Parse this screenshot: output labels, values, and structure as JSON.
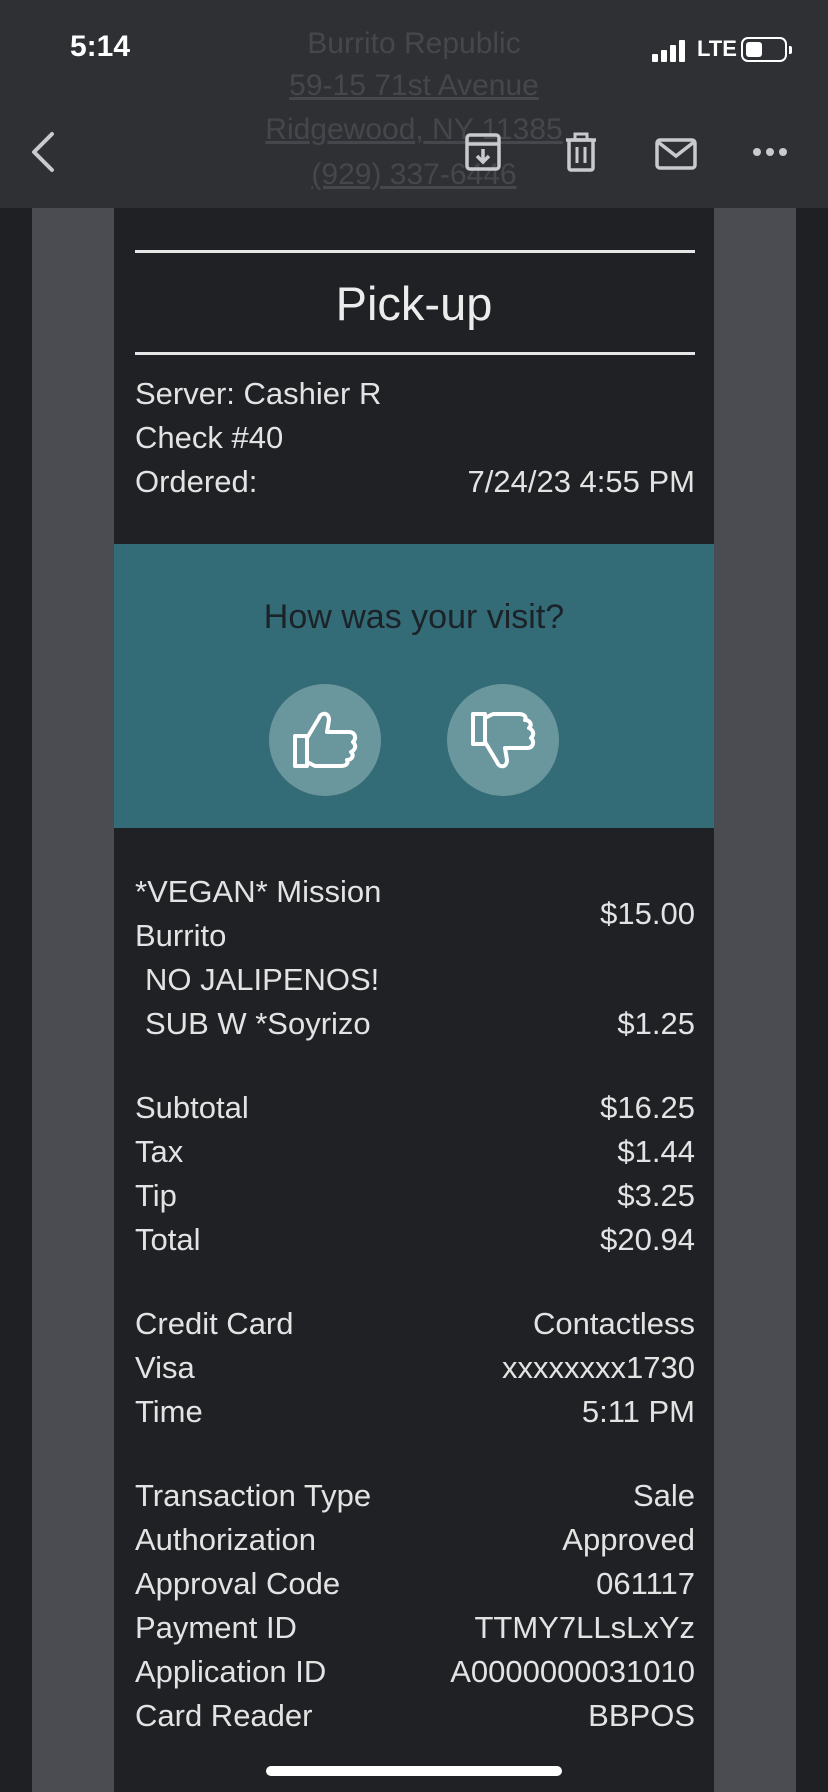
{
  "status_bar": {
    "time": "5:14",
    "network": "LTE"
  },
  "header_ghost": {
    "merchant": "Burrito Republic",
    "address_line1": "59-15 71st Avenue",
    "address_line2": "Ridgewood, NY 11385",
    "phone": "(929) 337-6446"
  },
  "toolbar": {
    "icons": [
      "chevron-left-icon",
      "archive-icon",
      "trash-icon",
      "mail-icon",
      "more-icon"
    ]
  },
  "receipt": {
    "order_type": "Pick-up",
    "server": "Server: Cashier R",
    "check": "Check #40",
    "ordered_label": "Ordered:",
    "ordered_value": "7/24/23 4:55 PM",
    "feedback": {
      "question": "How was your visit?",
      "accent": "#336b77"
    },
    "items": [
      {
        "name_line1": "*VEGAN* Mission",
        "name_line2": "Burrito",
        "price": "$15.00"
      },
      {
        "modifier": "NO JALIPENOS!"
      },
      {
        "modifier": "SUB W *Soyrizo",
        "price": "$1.25"
      }
    ],
    "totals": [
      {
        "label": "Subtotal",
        "value": "$16.25"
      },
      {
        "label": "Tax",
        "value": "$1.44"
      },
      {
        "label": "Tip",
        "value": "$3.25"
      },
      {
        "label": "Total",
        "value": "$20.94"
      }
    ],
    "payment": [
      {
        "label": "Credit Card",
        "value": "Contactless"
      },
      {
        "label": "Visa",
        "value": "xxxxxxxx1730"
      },
      {
        "label": "Time",
        "value": "5:11 PM"
      }
    ],
    "transaction": [
      {
        "label": "Transaction Type",
        "value": "Sale"
      },
      {
        "label": "Authorization",
        "value": "Approved"
      },
      {
        "label": "Approval Code",
        "value": "061117"
      },
      {
        "label": "Payment ID",
        "value": "TTMY7LLsLxYz"
      },
      {
        "label": "Application ID",
        "value": "A0000000031010"
      },
      {
        "label": "Card Reader",
        "value": "BBPOS"
      }
    ]
  }
}
